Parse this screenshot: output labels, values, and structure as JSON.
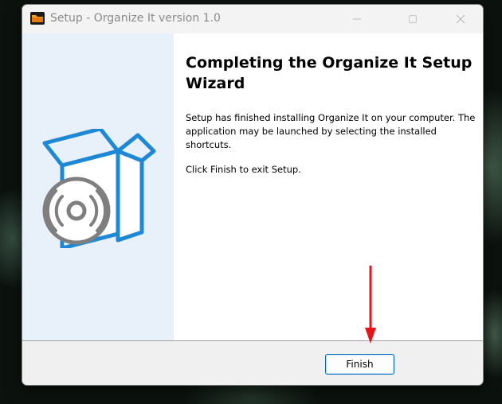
{
  "window": {
    "title": "Setup - Organize It version 1.0",
    "icon": "folder-app-icon",
    "controls": [
      "minimize-icon",
      "maximize-icon",
      "close-icon"
    ]
  },
  "wizard": {
    "heading": "Completing the Organize It Setup Wizard",
    "paragraph1": "Setup has finished installing Organize It on your computer. The application may be launched by selecting the installed shortcuts.",
    "paragraph2": "Click Finish to exit Setup.",
    "illustration": "software-box-cd-icon"
  },
  "footer": {
    "finish_label": "Finish"
  },
  "annotation": {
    "arrow_color": "#e8141b",
    "icon": "red-arrow-down-icon"
  },
  "colors": {
    "left_panel": "#e8f1fa",
    "box_blue": "#1e88d6",
    "disc_gray": "#7f7f7f",
    "button_border": "#0067c0"
  }
}
